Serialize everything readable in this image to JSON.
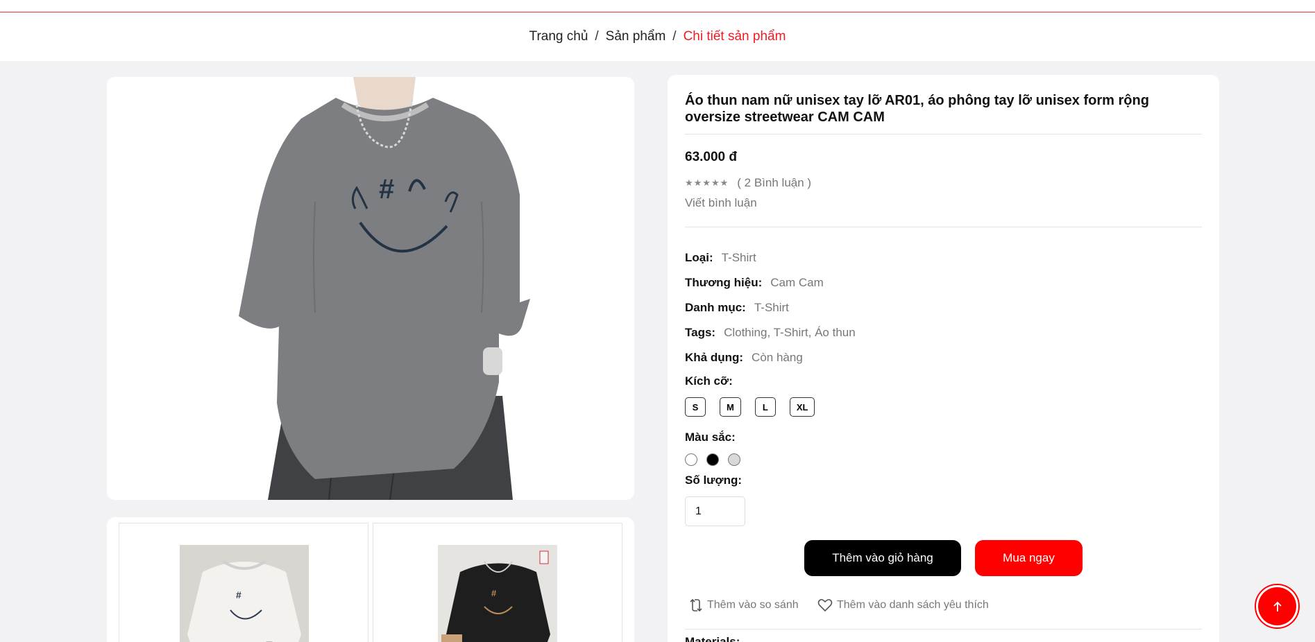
{
  "breadcrumb": {
    "items": [
      "Trang chủ",
      "Sản phẩm"
    ],
    "separator": "/",
    "current": "Chi tiết sản phẩm"
  },
  "product": {
    "title": "Áo thun nam nữ unisex tay lỡ AR01, áo phông tay lỡ unisex form rộng oversize streetwear CAM CAM",
    "price": "63.000 đ",
    "stars": "★★★★★",
    "rating_count_text": "( 2 Bình luận )",
    "write_review": "Viết bình luận",
    "specs": [
      {
        "label": "Loại:",
        "value": "T-Shirt"
      },
      {
        "label": "Thương hiệu:",
        "value": "Cam Cam"
      },
      {
        "label": "Danh mục:",
        "value": "T-Shirt"
      },
      {
        "label": "Tags:",
        "value": "Clothing, T-Shirt, Áo thun"
      },
      {
        "label": "Khả dụng:",
        "value": "Còn hàng"
      }
    ],
    "size_label": "Kích cỡ:",
    "sizes": [
      "S",
      "M",
      "L",
      "XL"
    ],
    "color_label": "Màu sắc:",
    "colors": [
      "#ffffff",
      "#000000",
      "#d9d9d9"
    ],
    "quantity_label": "Số lượng:",
    "quantity": "1",
    "add_to_cart": "Thêm vào giỏ hàng",
    "buy_now": "Mua ngay",
    "compare": "Thêm vào so sánh",
    "wishlist": "Thêm vào danh sách yêu thích",
    "materials_label": "Materials:"
  },
  "colors": {
    "accent": "#ff0000",
    "breadcrumb_current": "#ee1c25"
  }
}
